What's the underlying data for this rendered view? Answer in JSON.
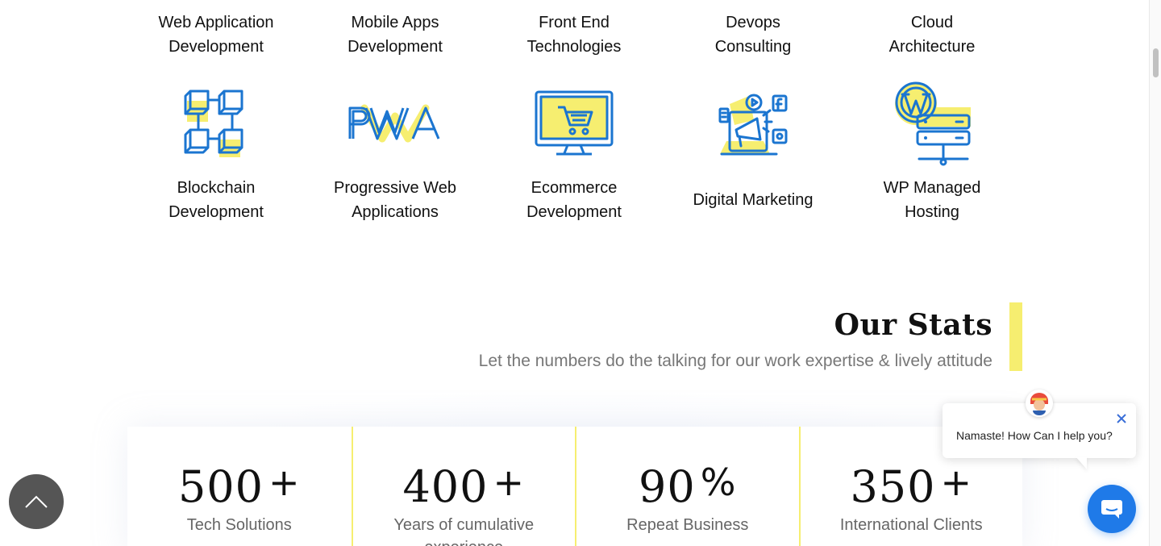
{
  "services_row1": [
    {
      "line1": "Web Application",
      "line2": "Development"
    },
    {
      "line1": "Mobile Apps",
      "line2": "Development"
    },
    {
      "line1": "Front End",
      "line2": "Technologies"
    },
    {
      "line1": "Devops",
      "line2": "Consulting"
    },
    {
      "line1": "Cloud",
      "line2": "Architecture"
    }
  ],
  "services_row2": [
    {
      "line1": "Blockchain",
      "line2": "Development",
      "icon": "blockchain-icon"
    },
    {
      "line1": "Progressive Web",
      "line2": "Applications",
      "icon": "pwa-icon"
    },
    {
      "line1": "Ecommerce",
      "line2": "Development",
      "icon": "ecommerce-icon"
    },
    {
      "line1": "Digital Marketing",
      "line2": "",
      "icon": "digital-marketing-icon"
    },
    {
      "line1": "WP Managed",
      "line2": "Hosting",
      "icon": "wp-hosting-icon"
    }
  ],
  "pwa_icon_text": "PWA",
  "stats": {
    "title": "Our Stats",
    "subtitle": "Let the numbers do the talking for our work expertise & lively attitude",
    "items": [
      {
        "number": "500",
        "suffix": "+",
        "label": "Tech Solutions"
      },
      {
        "number": "400",
        "suffix": "+",
        "label": "Years of cumulative experience"
      },
      {
        "number": "90",
        "suffix": "%",
        "label": "Repeat Business"
      },
      {
        "number": "350",
        "suffix": "+",
        "label": "International Clients"
      }
    ]
  },
  "chat": {
    "message": "Namaste! How Can I help you?",
    "close_icon": "close-icon",
    "launcher_icon": "chat-bubble-icon"
  },
  "back_to_top_icon": "chevron-up-icon",
  "colors": {
    "accent_yellow": "#f6ee70",
    "icon_blue": "#1b75d0",
    "chat_blue": "#1f7ae8",
    "back_top_gray": "#555555"
  }
}
